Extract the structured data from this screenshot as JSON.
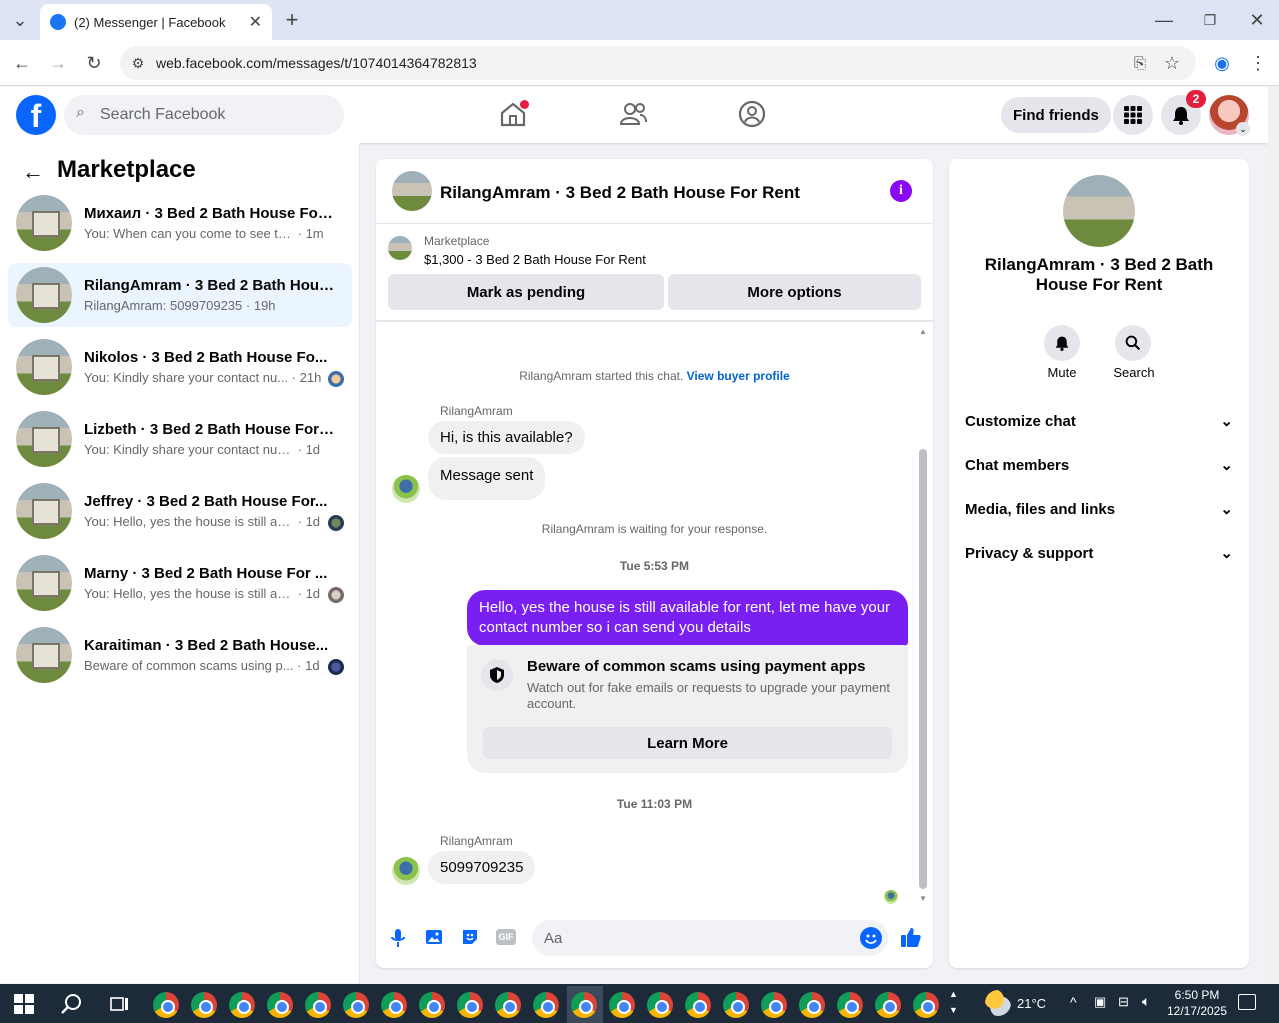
{
  "browser": {
    "tab_title": "(2) Messenger | Facebook",
    "url": "web.facebook.com/messages/t/1074014364782813"
  },
  "fb_header": {
    "search_placeholder": "Search Facebook",
    "find_friends": "Find friends",
    "notification_count": "2"
  },
  "sidebar": {
    "title": "Marketplace",
    "conversations": [
      {
        "name": "Михаил · 3 Bed 2 Bath House For ...",
        "preview": "You: When can you come to see the ...",
        "time": "· 1m"
      },
      {
        "name": "RilangAmram · 3 Bed 2 Bath Hous...",
        "preview": "RilangAmram: 5099709235",
        "time": "· 19h"
      },
      {
        "name": "Nikolos · 3 Bed 2 Bath House Fo...",
        "preview": "You: Kindly share your contact nu...",
        "time": "· 21h"
      },
      {
        "name": "Lizbeth · 3 Bed 2 Bath House For R...",
        "preview": "You: Kindly share your contact numbe...",
        "time": "· 1d"
      },
      {
        "name": "Jeffrey · 3 Bed 2 Bath House For...",
        "preview": "You: Hello, yes the house is still ava...",
        "time": "· 1d"
      },
      {
        "name": "Marny · 3 Bed 2 Bath House For ...",
        "preview": "You: Hello, yes the house is still ava...",
        "time": "· 1d"
      },
      {
        "name": "Karaitiman · 3 Bed 2 Bath House...",
        "preview": "Beware of common scams using p...",
        "time": "· 1d"
      }
    ]
  },
  "chat": {
    "title": "RilangAmram · 3 Bed 2 Bath House For Rent",
    "listing_label": "Marketplace",
    "listing_detail": "$1,300 - 3 Bed 2 Bath House For Rent",
    "mark_pending": "Mark as pending",
    "more_options": "More options",
    "started_text": "RilangAmram started this chat.",
    "view_profile": "View buyer profile",
    "sender_name": "RilangAmram",
    "msg1": "Hi, is this available?",
    "msg2": "Message sent",
    "waiting": "RilangAmram is waiting for your response.",
    "time1": "Tue 5:53 PM",
    "my_msg": "Hello, yes the house is still available for rent, let me have your contact number so i can send you  details",
    "scam_title": "Beware of common scams using payment apps",
    "scam_body": "Watch out for fake emails or requests to upgrade your payment account.",
    "learn_more": "Learn More",
    "time2": "Tue 11:03 PM",
    "msg3": "5099709235",
    "input_placeholder": "Aa",
    "gif_label": "GIF"
  },
  "info_panel": {
    "name": "RilangAmram · 3 Bed 2 Bath House For Rent",
    "mute": "Mute",
    "search": "Search",
    "sections": [
      "Customize chat",
      "Chat members",
      "Media, files and links",
      "Privacy & support"
    ]
  },
  "taskbar": {
    "weather": "21°C",
    "time": "6:50 PM",
    "date": "12/17/2025"
  },
  "colors": {
    "accent": "#0866ff",
    "my_bubble": "#7a1ff2",
    "info_icon": "#8a09f2"
  }
}
